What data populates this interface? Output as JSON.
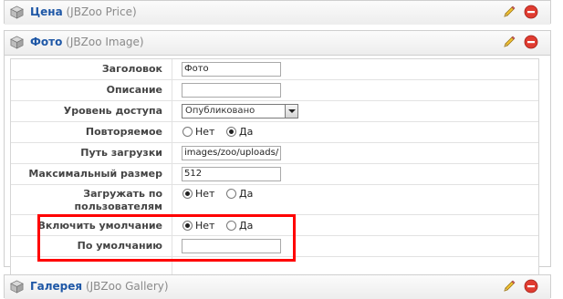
{
  "panels": {
    "price": {
      "title": "Цена",
      "subtitle": "(JBZoo Price)"
    },
    "foto": {
      "title": "Фото",
      "subtitle": "(JBZoo Image)"
    },
    "gallery": {
      "title": "Галерея",
      "subtitle": "(JBZoo Gallery)"
    }
  },
  "form": {
    "title_label": "Заголовок",
    "title_value": "Фото",
    "description_label": "Описание",
    "description_value": "",
    "access_label": "Уровень доступа",
    "access_value": "Опубликовано",
    "repeatable_label": "Повторяемое",
    "repeatable_options": [
      "Нет",
      "Да"
    ],
    "repeatable_selected": "Да",
    "upload_path_label": "Путь загрузки",
    "upload_path_value": "images/zoo/uploads/",
    "max_size_label": "Максимальный размер",
    "max_size_value": "512",
    "user_upload_label_line1": "Загружать по",
    "user_upload_label_line2": "пользователям",
    "user_upload_options": [
      "Нет",
      "Да"
    ],
    "user_upload_selected": "Нет",
    "enable_default_label": "Включить умолчание",
    "enable_default_options": [
      "Нет",
      "Да"
    ],
    "enable_default_selected": "Нет",
    "default_label": "По умолчанию",
    "default_value": ""
  },
  "icons": {
    "header_cube": "cube-icon",
    "edit": "pencil-icon",
    "remove": "minus-circle-icon"
  },
  "colors": {
    "title_link": "#1e57a6",
    "highlight": "#ff0000",
    "remove": "#e03c31"
  }
}
